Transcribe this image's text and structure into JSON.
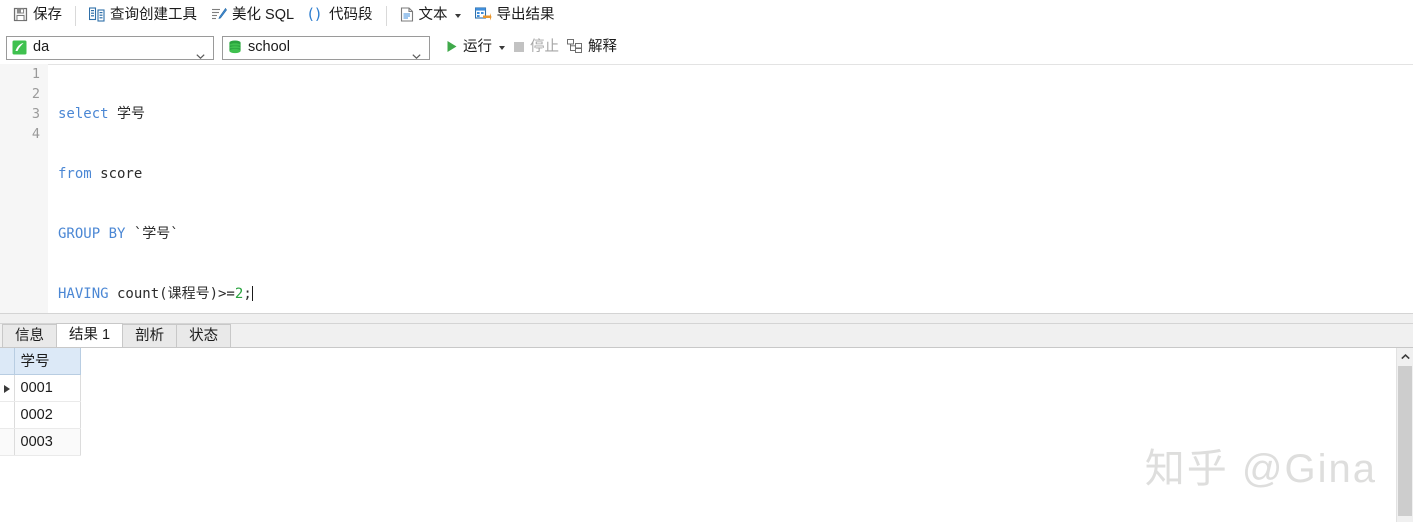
{
  "toolbar": {
    "items": [
      {
        "label": "保存",
        "icon": "save-icon"
      },
      {
        "label": "查询创建工具",
        "icon": "query-builder-icon"
      },
      {
        "label": "美化 SQL",
        "icon": "beautify-sql-icon"
      },
      {
        "label": "代码段",
        "icon": "code-snippet-icon"
      },
      {
        "label": "文本",
        "icon": "text-icon"
      },
      {
        "label": "导出结果",
        "icon": "export-result-icon"
      }
    ]
  },
  "connbar": {
    "connection": {
      "value": "da",
      "icon": "connection-icon"
    },
    "database": {
      "value": "school",
      "icon": "database-icon"
    },
    "run_label": "运行",
    "stop_label": "停止",
    "explain_label": "解释"
  },
  "editor": {
    "lines": [
      {
        "number": "1",
        "tokens": [
          {
            "text": "select",
            "type": "kw"
          },
          {
            "text": " 学号",
            "type": "idt"
          }
        ]
      },
      {
        "number": "2",
        "tokens": [
          {
            "text": "from",
            "type": "kw"
          },
          {
            "text": " score",
            "type": "idt"
          }
        ]
      },
      {
        "number": "3",
        "tokens": [
          {
            "text": "GROUP BY",
            "type": "kw"
          },
          {
            "text": " `学号`",
            "type": "idt"
          }
        ]
      },
      {
        "number": "4",
        "tokens": [
          {
            "text": "HAVING",
            "type": "kw"
          },
          {
            "text": " count(课程号)>=",
            "type": "idt"
          },
          {
            "text": "2",
            "type": "num"
          },
          {
            "text": ";",
            "type": "idt"
          }
        ]
      }
    ],
    "full_text": "select 学号\nfrom score\nGROUP BY `学号`\nHAVING count(课程号)>=2;"
  },
  "result_tabs": [
    {
      "label": "信息",
      "active": false
    },
    {
      "label": "结果 1",
      "active": true
    },
    {
      "label": "剖析",
      "active": false
    },
    {
      "label": "状态",
      "active": false
    }
  ],
  "result_grid": {
    "columns": [
      "学号"
    ],
    "rows": [
      {
        "values": [
          "0001"
        ],
        "selected": true
      },
      {
        "values": [
          "0002"
        ],
        "selected": false
      },
      {
        "values": [
          "0003"
        ],
        "selected": false
      }
    ]
  },
  "watermark": "知乎 @Gina",
  "colors": {
    "keyword": "#4b87d4",
    "number": "#2aa33f",
    "identifier": "#2b2b2b",
    "grid_header_bg": "#dce9f7",
    "accent_green": "#33b04a",
    "tab_bg": "#f0f0f0"
  }
}
